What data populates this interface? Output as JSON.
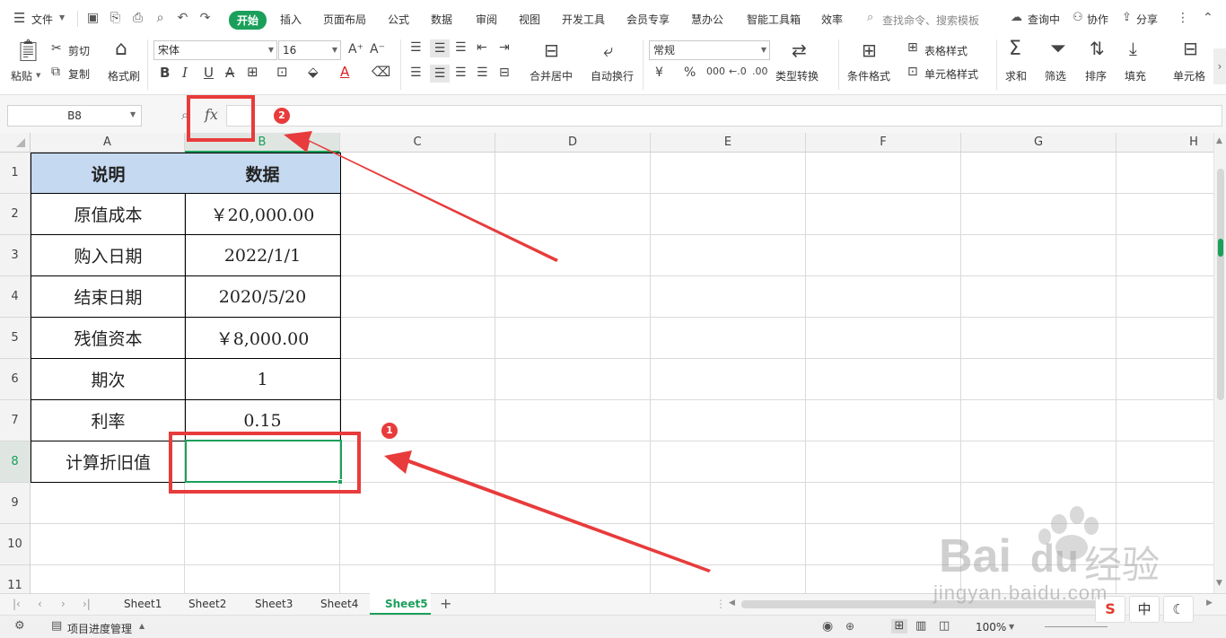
{
  "menubar": {
    "file_label": "文件",
    "tabs": [
      "开始",
      "插入",
      "页面布局",
      "公式",
      "数据",
      "审阅",
      "视图",
      "开发工具",
      "会员专享",
      "慧办公",
      "智能工具箱",
      "效率"
    ],
    "active_tab": "开始",
    "search_placeholder": "查找命令、搜索模板",
    "right": [
      "查询中",
      "协作",
      "分享"
    ]
  },
  "ribbon": {
    "paste": "粘贴",
    "cut": "剪切",
    "copy": "复制",
    "format_painter": "格式刷",
    "font_name": "宋体",
    "font_size": "16",
    "merge_center": "合并居中",
    "wrap_text": "自动换行",
    "number_format": "常规",
    "type_convert": "类型转换",
    "conditional_format": "条件格式",
    "table_style": "表格样式",
    "cell_style": "单元格样式",
    "sum": "求和",
    "filter": "筛选",
    "sort": "排序",
    "fill": "填充",
    "cells": "单元格",
    "currency_symbol": "¥",
    "percent_symbol": "%",
    "thousands_symbol": "000"
  },
  "formula_bar": {
    "name_box": "B8",
    "fx_label": "fx",
    "formula": ""
  },
  "grid": {
    "columns": [
      "A",
      "B",
      "C",
      "D",
      "E",
      "F",
      "G",
      "H"
    ],
    "rows": [
      "1",
      "2",
      "3",
      "4",
      "5",
      "6",
      "7",
      "8",
      "9",
      "10",
      "11"
    ],
    "selected_column": "B",
    "selected_row": "8",
    "table": [
      [
        "说明",
        "数据"
      ],
      [
        "原值成本",
        "￥20,000.00"
      ],
      [
        "购入日期",
        "2022/1/1"
      ],
      [
        "结束日期",
        "2020/5/20"
      ],
      [
        "残值资本",
        "￥8,000.00"
      ],
      [
        "期次",
        "1"
      ],
      [
        "利率",
        "0.15"
      ],
      [
        "计算折旧值",
        ""
      ]
    ]
  },
  "sheets": {
    "tabs": [
      "Sheet1",
      "Sheet2",
      "Sheet3",
      "Sheet4",
      "Sheet5"
    ],
    "active": "Sheet5",
    "add": "+"
  },
  "statusbar": {
    "project": "项目进度管理",
    "zoom": "100%",
    "ime_label": "中"
  },
  "annotations": {
    "badge_1": "1",
    "badge_2": "2"
  },
  "watermark": {
    "brand": "Bai",
    "brand2": "du",
    "product": "经验",
    "url": "jingyan.baidu.com"
  },
  "colors": {
    "accent": "#1aa05a",
    "header_fill": "#c5d9f0",
    "annotation": "#e83b3b"
  }
}
